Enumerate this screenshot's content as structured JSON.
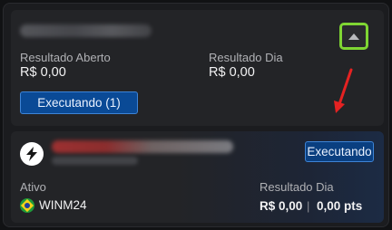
{
  "colors": {
    "accent_blue": "#0a4a96",
    "highlight_green": "#7fd633",
    "arrow_red": "#e52222"
  },
  "top_card": {
    "collapse_icon": "triangle-up-icon",
    "result_open_label": "Resultado Aberto",
    "result_open_value": "R$ 0,00",
    "result_day_label": "Resultado Dia",
    "result_day_value": "R$ 0,00",
    "running_button_label": "Executando (1)"
  },
  "bottom_card": {
    "logo_icon": "lightning-logo-icon",
    "status_badge": "Executando",
    "asset_label": "Ativo",
    "asset_flag_icon": "brazil-flag-icon",
    "asset_value": "WINM24",
    "result_day_label": "Resultado Dia",
    "result_day_value": "R$ 0,00",
    "separator": "|",
    "result_day_points": "0,00 pts"
  }
}
